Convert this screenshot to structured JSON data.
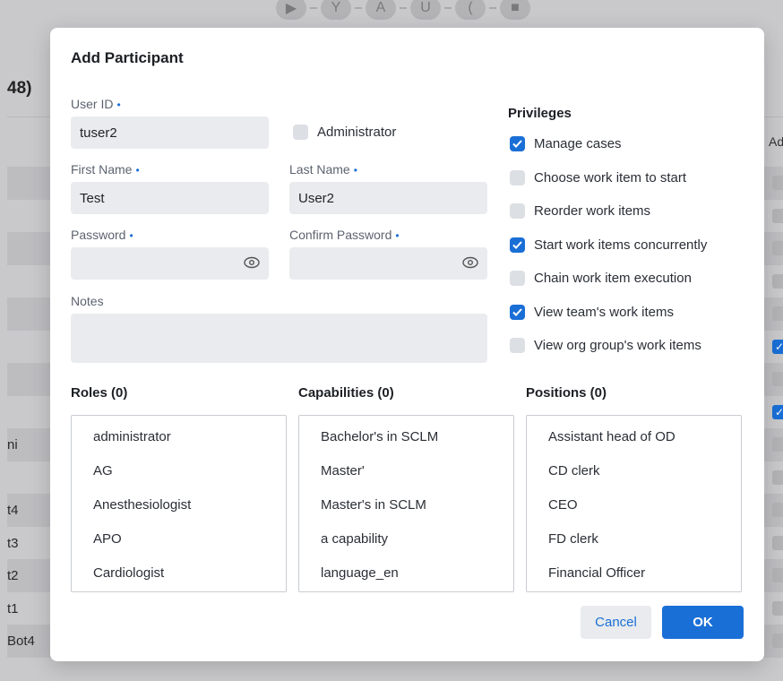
{
  "background": {
    "count_fragment": "48)",
    "adm_header_fragment": "Adr",
    "toolbar_icons": [
      "play-icon",
      "fork-icon",
      "atomic-icon",
      "composite-icon",
      "loop-icon",
      "stop-icon"
    ],
    "rows": [
      {
        "text": ""
      },
      {
        "text": ""
      },
      {
        "text": ""
      },
      {
        "text": ""
      },
      {
        "text": ""
      },
      {
        "text": ""
      },
      {
        "text": ""
      },
      {
        "text": ""
      },
      {
        "text": "ni"
      },
      {
        "text": ""
      },
      {
        "text": "t4"
      },
      {
        "text": "t3"
      },
      {
        "text": "t2"
      },
      {
        "text": "t1"
      },
      {
        "text": "Bot4"
      }
    ]
  },
  "dialog": {
    "title": "Add Participant",
    "user_id": {
      "label": "User ID",
      "value": "tuser2"
    },
    "administrator": {
      "label": "Administrator",
      "checked": false
    },
    "first_name": {
      "label": "First Name",
      "value": "Test"
    },
    "last_name": {
      "label": "Last Name",
      "value": "User2"
    },
    "password": {
      "label": "Password",
      "value": ""
    },
    "confirm_password": {
      "label": "Confirm Password",
      "value": ""
    },
    "notes": {
      "label": "Notes",
      "value": ""
    },
    "required_marker": "•",
    "privileges": {
      "title": "Privileges",
      "items": [
        {
          "label": "Manage cases",
          "checked": true
        },
        {
          "label": "Choose work item to start",
          "checked": false
        },
        {
          "label": "Reorder work items",
          "checked": false
        },
        {
          "label": "Start work items concurrently",
          "checked": true
        },
        {
          "label": "Chain work item execution",
          "checked": false
        },
        {
          "label": "View team's work items",
          "checked": true
        },
        {
          "label": "View org group's work items",
          "checked": false
        }
      ]
    },
    "roles": {
      "title": "Roles (0)",
      "items": [
        "administrator",
        "AG",
        "Anesthesiologist",
        "APO",
        "Cardiologist"
      ]
    },
    "capabilities": {
      "title": "Capabilities (0)",
      "items": [
        "Bachelor's in SCLM",
        "Master'",
        "Master's in SCLM",
        "a capability",
        "language_en"
      ]
    },
    "positions": {
      "title": "Positions (0)",
      "items": [
        "Assistant head of OD",
        "CD clerk",
        "CEO",
        "FD clerk",
        "Financial Officer"
      ]
    },
    "buttons": {
      "cancel": "Cancel",
      "ok": "OK"
    }
  },
  "colors": {
    "accent": "#1a6fd6",
    "field_bg": "#e9ebee",
    "overlay": "#c9c9cb"
  }
}
